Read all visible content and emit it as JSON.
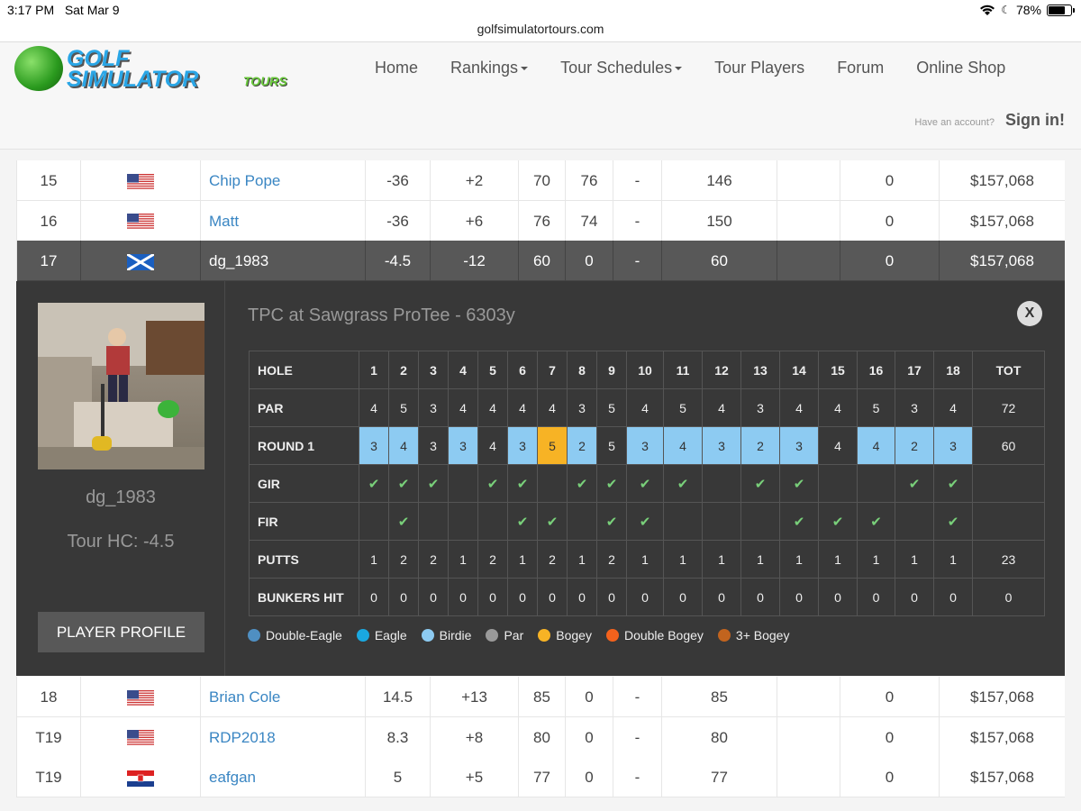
{
  "status": {
    "time": "3:17 PM",
    "date": "Sat Mar 9",
    "battery": "78%",
    "battery_level": 0.78
  },
  "url": "golfsimulatortours.com",
  "logo": {
    "line1": "GOLF",
    "line2": "SIMULATOR",
    "line3": "TOURS"
  },
  "nav": [
    {
      "label": "Home"
    },
    {
      "label": "Rankings"
    },
    {
      "label": "Tour Schedules"
    },
    {
      "label": "Tour Players"
    },
    {
      "label": "Forum"
    },
    {
      "label": "Online Shop"
    }
  ],
  "account": {
    "question": "Have an account?",
    "signin": "Sign in!"
  },
  "rows_top": [
    {
      "pos": "15",
      "flag": "us-flag",
      "name": "Chip Pope",
      "hc": "-36",
      "topar": "+2",
      "r1": "70",
      "r2": "76",
      "r3": "-",
      "total": "146",
      "col9": "",
      "pts": "0",
      "money": "$157,068"
    },
    {
      "pos": "16",
      "flag": "us-flag",
      "name": "Matt",
      "hc": "-36",
      "topar": "+6",
      "r1": "76",
      "r2": "74",
      "r3": "-",
      "total": "150",
      "col9": "",
      "pts": "0",
      "money": "$157,068"
    },
    {
      "pos": "17",
      "flag": "scotland-flag",
      "name": "dg_1983",
      "hc": "-4.5",
      "topar": "-12",
      "r1": "60",
      "r2": "0",
      "r3": "-",
      "total": "60",
      "col9": "",
      "pts": "0",
      "money": "$157,068"
    }
  ],
  "rows_bottom": [
    {
      "pos": "18",
      "flag": "us-flag",
      "name": "Brian Cole",
      "hc": "14.5",
      "topar": "+13",
      "r1": "85",
      "r2": "0",
      "r3": "-",
      "total": "85",
      "col9": "",
      "pts": "0",
      "money": "$157,068"
    },
    {
      "pos": "T19",
      "flag": "us-flag",
      "name": "RDP2018",
      "hc": "8.3",
      "topar": "+8",
      "r1": "80",
      "r2": "0",
      "r3": "-",
      "total": "80",
      "col9": "",
      "pts": "0",
      "money": "$157,068"
    },
    {
      "pos": "T19",
      "flag": "croatia-flag",
      "name": "eafgan",
      "hc": "5",
      "topar": "+5",
      "r1": "77",
      "r2": "0",
      "r3": "-",
      "total": "77",
      "col9": "",
      "pts": "0",
      "money": "$157,068"
    }
  ],
  "player": {
    "name": "dg_1983",
    "hc": "Tour HC: -4.5",
    "profile_button": "PLAYER PROFILE",
    "course": "TPC at Sawgrass ProTee - 6303y",
    "close": "X"
  },
  "scorecard": {
    "hole_label": "HOLE",
    "holes": [
      "1",
      "2",
      "3",
      "4",
      "5",
      "6",
      "7",
      "8",
      "9",
      "10",
      "11",
      "12",
      "13",
      "14",
      "15",
      "16",
      "17",
      "18"
    ],
    "tot_label": "TOT",
    "par_label": "PAR",
    "par": [
      "4",
      "5",
      "3",
      "4",
      "4",
      "4",
      "4",
      "3",
      "5",
      "4",
      "5",
      "4",
      "3",
      "4",
      "4",
      "5",
      "3",
      "4"
    ],
    "par_tot": "72",
    "round_label": "ROUND 1",
    "round": [
      "3",
      "4",
      "3",
      "3",
      "4",
      "3",
      "5",
      "2",
      "5",
      "3",
      "4",
      "3",
      "2",
      "3",
      "4",
      "4",
      "2",
      "3"
    ],
    "round_class": [
      "birdie",
      "birdie",
      "",
      "birdie",
      "",
      "birdie",
      "bogey",
      "birdie",
      "",
      "birdie",
      "birdie",
      "birdie",
      "birdie",
      "birdie",
      "",
      "birdie",
      "birdie",
      "birdie"
    ],
    "round_tot": "60",
    "gir_label": "GIR",
    "gir": [
      1,
      1,
      1,
      0,
      1,
      1,
      0,
      1,
      1,
      1,
      1,
      0,
      1,
      1,
      0,
      0,
      1,
      1
    ],
    "fir_label": "FIR",
    "fir": [
      0,
      1,
      0,
      0,
      0,
      1,
      1,
      0,
      1,
      1,
      0,
      0,
      0,
      1,
      1,
      1,
      0,
      1
    ],
    "putts_label": "PUTTS",
    "putts": [
      "1",
      "2",
      "2",
      "1",
      "2",
      "1",
      "2",
      "1",
      "2",
      "1",
      "1",
      "1",
      "1",
      "1",
      "1",
      "1",
      "1",
      "1"
    ],
    "putts_tot": "23",
    "bunkers_label": "BUNKERS HIT",
    "bunkers": [
      "0",
      "0",
      "0",
      "0",
      "0",
      "0",
      "0",
      "0",
      "0",
      "0",
      "0",
      "0",
      "0",
      "0",
      "0",
      "0",
      "0",
      "0"
    ],
    "bunkers_tot": "0",
    "check_glyph": "✔"
  },
  "legend": [
    {
      "label": "Double-Eagle",
      "color": "#4f8fc2"
    },
    {
      "label": "Eagle",
      "color": "#1aa8e0"
    },
    {
      "label": "Birdie",
      "color": "#8dcbf2"
    },
    {
      "label": "Par",
      "color": "#9a9a9a"
    },
    {
      "label": "Bogey",
      "color": "#f7b325"
    },
    {
      "label": "Double Bogey",
      "color": "#f4621c"
    },
    {
      "label": "3+ Bogey",
      "color": "#c2641e"
    }
  ]
}
